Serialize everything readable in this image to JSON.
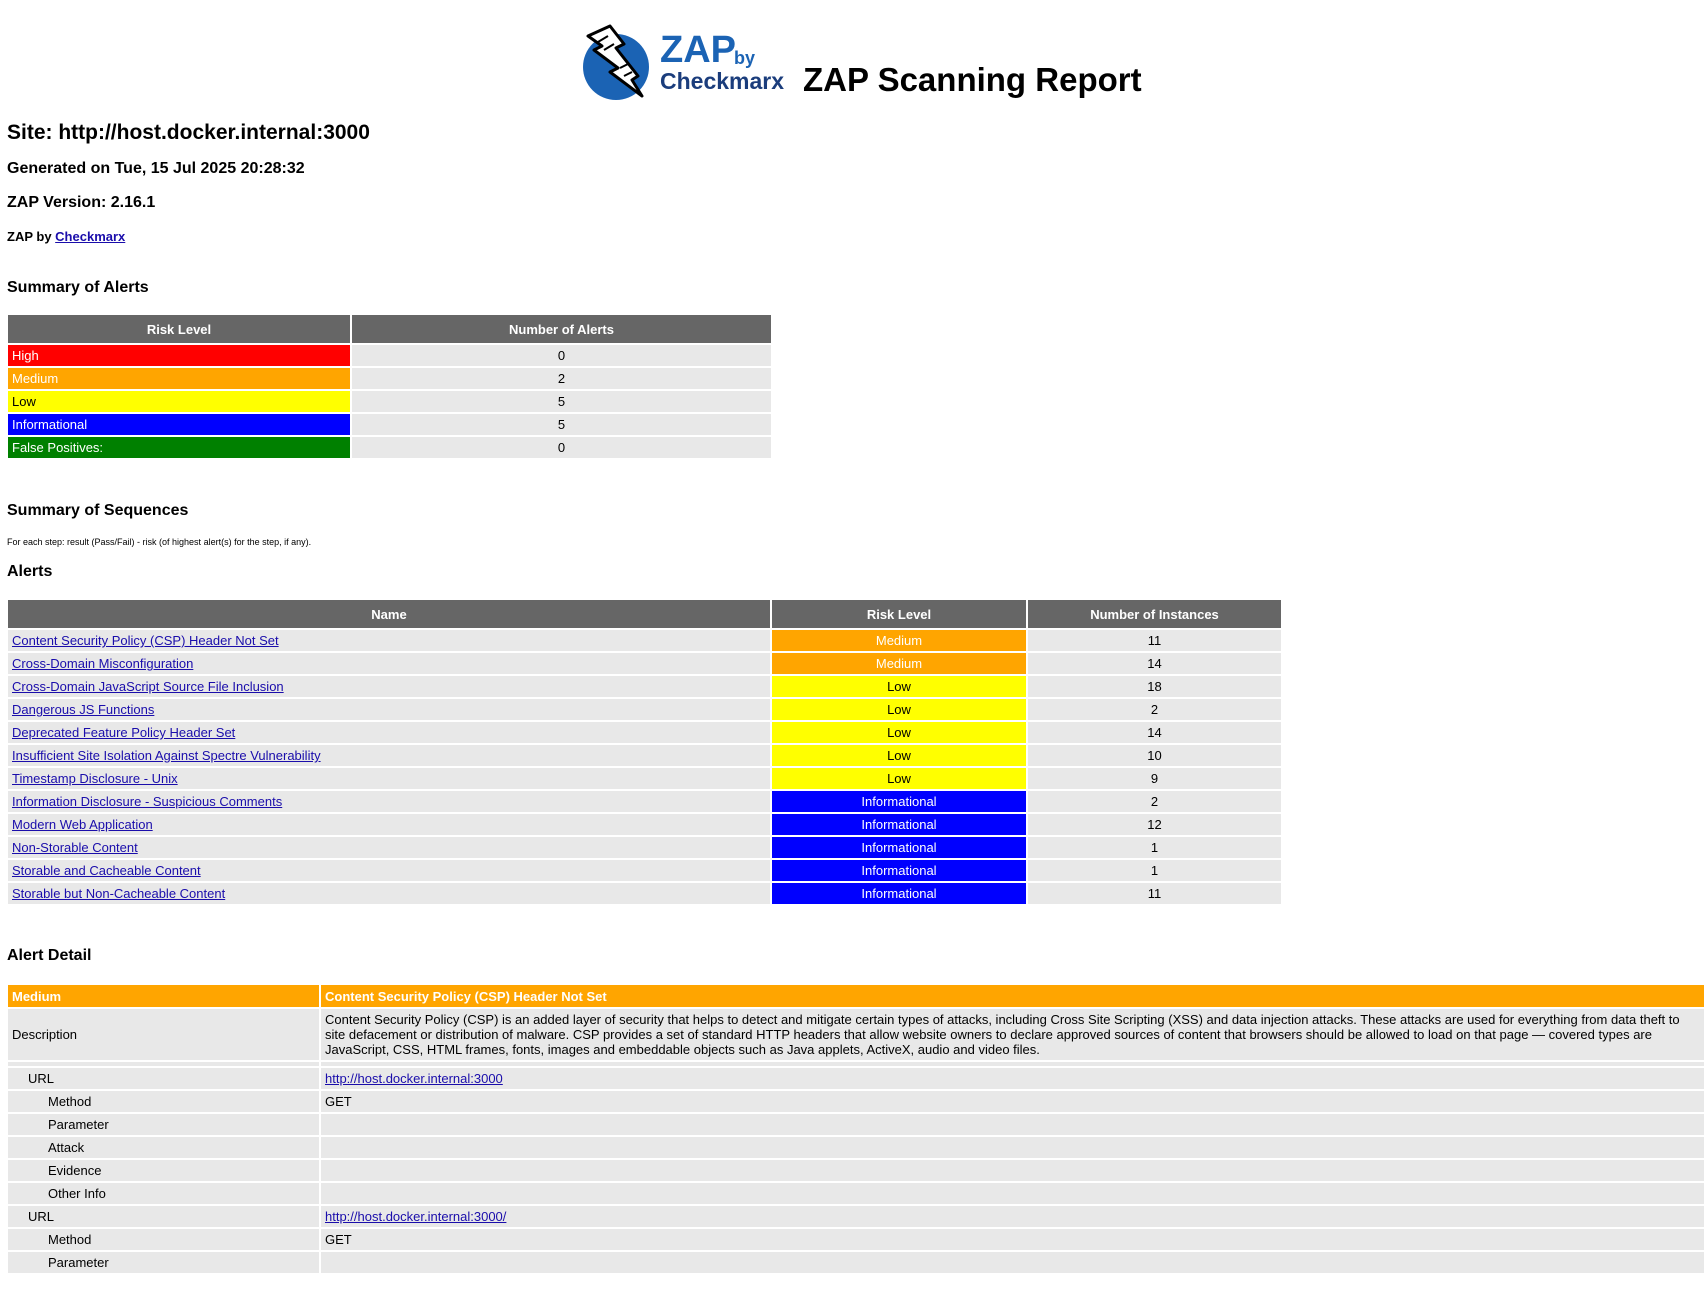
{
  "header": {
    "logo_zap": "ZAP",
    "logo_by": "by",
    "logo_checkmarx": "Checkmarx",
    "report_title": "ZAP Scanning Report"
  },
  "site": "Site: http://host.docker.internal:3000",
  "generated": "Generated on Tue, 15 Jul 2025 20:28:32",
  "version": "ZAP Version: 2.16.1",
  "by_prefix": "ZAP by ",
  "by_link": "Checkmarx",
  "summary_alerts": {
    "title": "Summary of Alerts",
    "headers": [
      "Risk Level",
      "Number of Alerts"
    ],
    "rows": [
      {
        "level": "High",
        "count": "0"
      },
      {
        "level": "Medium",
        "count": "2"
      },
      {
        "level": "Low",
        "count": "5"
      },
      {
        "level": "Informational",
        "count": "5"
      },
      {
        "level": "False Positives:",
        "count": "0"
      }
    ]
  },
  "summary_sequences": {
    "title": "Summary of Sequences",
    "note": "For each step: result (Pass/Fail) - risk (of highest alert(s) for the step, if any)."
  },
  "alerts": {
    "title": "Alerts",
    "headers": [
      "Name",
      "Risk Level",
      "Number of Instances"
    ],
    "rows": [
      {
        "name": "Content Security Policy (CSP) Header Not Set",
        "risk": "Medium",
        "count": "11"
      },
      {
        "name": "Cross-Domain Misconfiguration",
        "risk": "Medium",
        "count": "14"
      },
      {
        "name": "Cross-Domain JavaScript Source File Inclusion",
        "risk": "Low",
        "count": "18"
      },
      {
        "name": "Dangerous JS Functions",
        "risk": "Low",
        "count": "2"
      },
      {
        "name": "Deprecated Feature Policy Header Set",
        "risk": "Low",
        "count": "14"
      },
      {
        "name": "Insufficient Site Isolation Against Spectre Vulnerability",
        "risk": "Low",
        "count": "10"
      },
      {
        "name": "Timestamp Disclosure - Unix",
        "risk": "Low",
        "count": "9"
      },
      {
        "name": "Information Disclosure - Suspicious Comments",
        "risk": "Informational",
        "count": "2"
      },
      {
        "name": "Modern Web Application",
        "risk": "Informational",
        "count": "12"
      },
      {
        "name": "Non-Storable Content",
        "risk": "Informational",
        "count": "1"
      },
      {
        "name": "Storable and Cacheable Content",
        "risk": "Informational",
        "count": "1"
      },
      {
        "name": "Storable but Non-Cacheable Content",
        "risk": "Informational",
        "count": "11"
      }
    ]
  },
  "alert_detail": {
    "title": "Alert Detail",
    "risk": "Medium",
    "name": "Content Security Policy (CSP) Header Not Set",
    "description_label": "Description",
    "description": "Content Security Policy (CSP) is an added layer of security that helps to detect and mitigate certain types of attacks, including Cross Site Scripting (XSS) and data injection attacks. These attacks are used for everything from data theft to site defacement or distribution of malware. CSP provides a set of standard HTTP headers that allow website owners to declare approved sources of content that browsers should be allowed to load on that page — covered types are JavaScript, CSS, HTML frames, fonts, images and embeddable objects such as Java applets, ActiveX, audio and video files.",
    "instances": [
      {
        "url_label": "URL",
        "url": "http://host.docker.internal:3000",
        "fields": [
          {
            "label": "Method",
            "value": "GET"
          },
          {
            "label": "Parameter",
            "value": ""
          },
          {
            "label": "Attack",
            "value": ""
          },
          {
            "label": "Evidence",
            "value": ""
          },
          {
            "label": "Other Info",
            "value": ""
          }
        ]
      },
      {
        "url_label": "URL",
        "url": "http://host.docker.internal:3000/",
        "fields": [
          {
            "label": "Method",
            "value": "GET"
          },
          {
            "label": "Parameter",
            "value": ""
          }
        ]
      }
    ]
  },
  "colors": {
    "high": "#ff0000",
    "medium": "#ffa500",
    "low": "#ffff00",
    "informational": "#0000ff",
    "false_positive": "#008000",
    "header_bg": "#666666",
    "row_bg": "#e8e8e8"
  }
}
